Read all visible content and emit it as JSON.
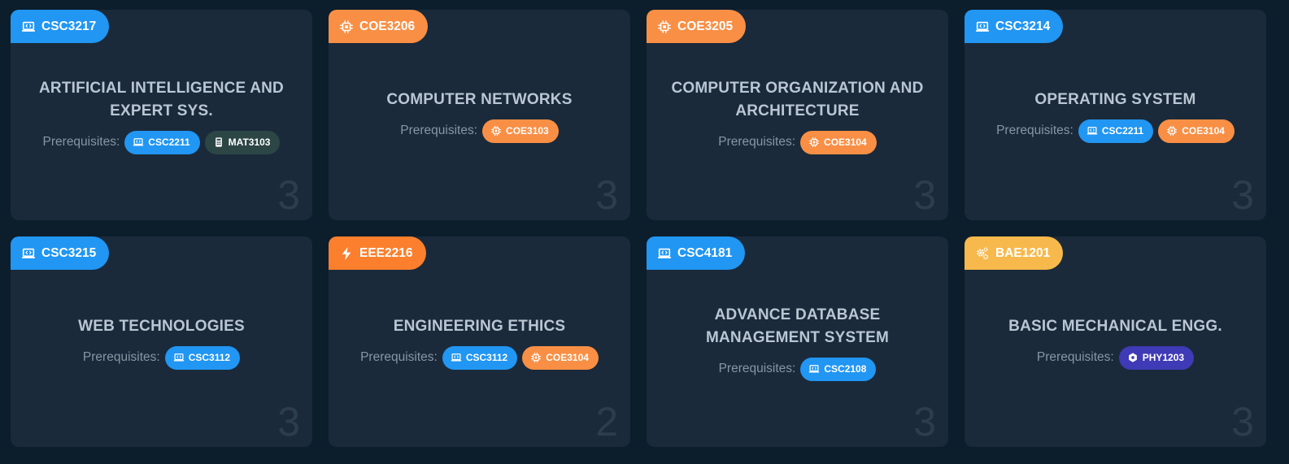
{
  "colors": {
    "blue": "#2196f3",
    "orange": "#f98f45",
    "deep_orange": "#fb7f2c",
    "yellow": "#f7b94b",
    "dark_teal": "#2c4646",
    "indigo": "#3f3ab5"
  },
  "prereq_label": "Prerequisites:",
  "courses": [
    {
      "code": "CSC3217",
      "icon": "laptop-code-icon",
      "color": "blue",
      "title": "ARTIFICIAL INTELLIGENCE AND EXPERT SYS.",
      "credits": "3",
      "prerequisites": [
        {
          "code": "CSC2211",
          "icon": "laptop-code-icon",
          "color": "blue"
        },
        {
          "code": "MAT3103",
          "icon": "calculator-icon",
          "color": "dark_teal"
        }
      ]
    },
    {
      "code": "COE3206",
      "icon": "chip-icon",
      "color": "orange",
      "title": "COMPUTER NETWORKS",
      "credits": "3",
      "prerequisites": [
        {
          "code": "COE3103",
          "icon": "chip-icon",
          "color": "orange"
        }
      ]
    },
    {
      "code": "COE3205",
      "icon": "chip-icon",
      "color": "orange",
      "title": "COMPUTER ORGANIZATION AND ARCHITECTURE",
      "credits": "3",
      "prerequisites": [
        {
          "code": "COE3104",
          "icon": "chip-icon",
          "color": "orange"
        }
      ]
    },
    {
      "code": "CSC3214",
      "icon": "laptop-code-icon",
      "color": "blue",
      "title": "OPERATING SYSTEM",
      "credits": "3",
      "prerequisites": [
        {
          "code": "CSC2211",
          "icon": "laptop-code-icon",
          "color": "blue"
        },
        {
          "code": "COE3104",
          "icon": "chip-icon",
          "color": "orange"
        }
      ]
    },
    {
      "code": "CSC3215",
      "icon": "laptop-code-icon",
      "color": "blue",
      "title": "WEB TECHNOLOGIES",
      "credits": "3",
      "prerequisites": [
        {
          "code": "CSC3112",
          "icon": "laptop-code-icon",
          "color": "blue"
        }
      ]
    },
    {
      "code": "EEE2216",
      "icon": "bolt-icon",
      "color": "deep_orange",
      "title": "ENGINEERING ETHICS",
      "credits": "2",
      "prerequisites": [
        {
          "code": "CSC3112",
          "icon": "laptop-code-icon",
          "color": "blue"
        },
        {
          "code": "COE3104",
          "icon": "chip-icon",
          "color": "orange"
        }
      ]
    },
    {
      "code": "CSC4181",
      "icon": "laptop-code-icon",
      "color": "blue",
      "title": "ADVANCE DATABASE MANAGEMENT SYSTEM",
      "credits": "3",
      "prerequisites": [
        {
          "code": "CSC2108",
          "icon": "laptop-code-icon",
          "color": "blue"
        }
      ]
    },
    {
      "code": "BAE1201",
      "icon": "gears-icon",
      "color": "yellow",
      "title": "BASIC MECHANICAL ENGG.",
      "credits": "3",
      "prerequisites": [
        {
          "code": "PHY1203",
          "icon": "atom-icon",
          "color": "indigo"
        }
      ]
    }
  ]
}
